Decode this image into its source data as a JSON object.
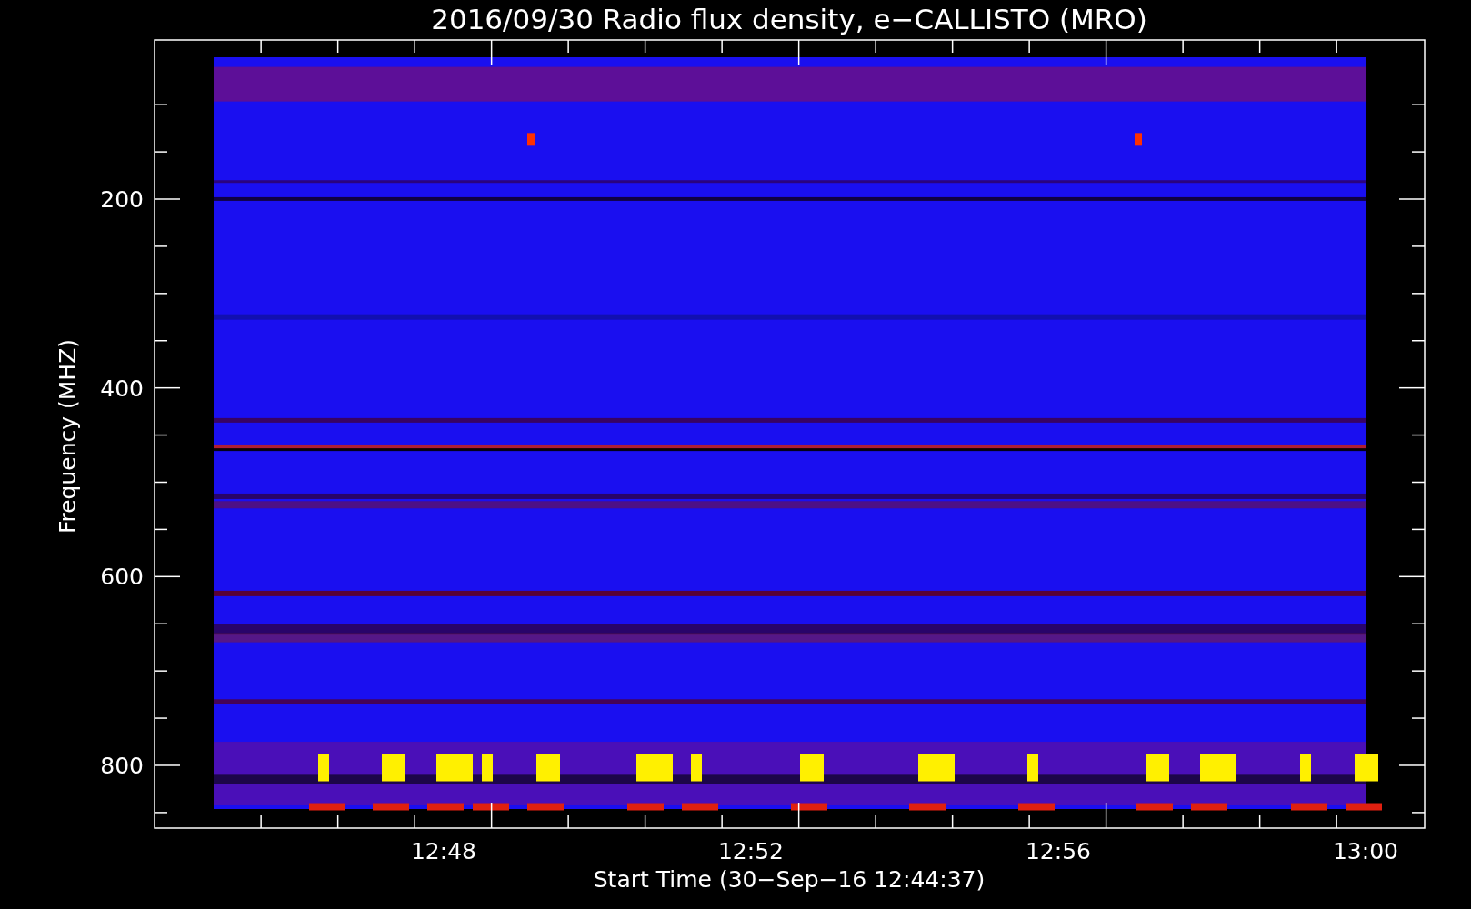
{
  "title": "2016/09/30  Radio flux density, e−CALLISTO (MRO)",
  "x_axis": {
    "label": "Start Time (30−Sep−16 12:44:37)",
    "ticks": [
      "12:48",
      "12:52",
      "12:56",
      "13:00"
    ]
  },
  "y_axis": {
    "label": "Frequency (MHZ)",
    "ticks": [
      "200",
      "400",
      "600",
      "800"
    ]
  }
}
